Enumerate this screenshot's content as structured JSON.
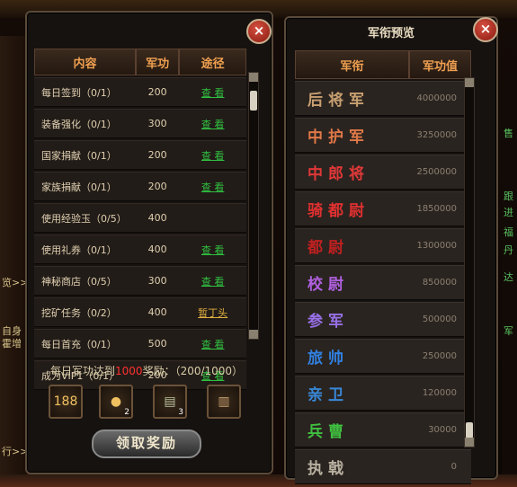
{
  "left_panel": {
    "columns": [
      "内容",
      "军功",
      "途径"
    ],
    "rows": [
      {
        "content": "每日签到（0/1）",
        "merit": "200",
        "action": "查  看"
      },
      {
        "content": "装备强化（0/1）",
        "merit": "300",
        "action": "查  看"
      },
      {
        "content": "国家捐献（0/1）",
        "merit": "200",
        "action": "查  看"
      },
      {
        "content": "家族捐献（0/1）",
        "merit": "200",
        "action": "查  看"
      },
      {
        "content": "使用经验玉（0/5）",
        "merit": "400",
        "action": ""
      },
      {
        "content": "使用礼券（0/1）",
        "merit": "400",
        "action": "查  看"
      },
      {
        "content": "神秘商店（0/5）",
        "merit": "300",
        "action": "查  看"
      },
      {
        "content": "挖矿任务（0/2）",
        "merit": "400",
        "action": "暂丁头"
      },
      {
        "content": "每日首充（0/1）",
        "merit": "500",
        "action": "查  看"
      },
      {
        "content": "成为VIP1（0/1）",
        "merit": "200",
        "action": "查  看"
      }
    ],
    "goal_prefix": "每日军功达到",
    "goal_amount": "1000",
    "goal_suffix": "奖励：（200/1000）",
    "rewards": [
      {
        "icon": "gold-ticket-icon",
        "label": "188",
        "count": ""
      },
      {
        "icon": "fire-orb-icon",
        "label": "",
        "count": "2"
      },
      {
        "icon": "scroll-icon",
        "label": "",
        "count": "3"
      },
      {
        "icon": "bamboo-scroll-icon",
        "label": "",
        "count": ""
      }
    ],
    "claim_button": "领取奖励",
    "close_label": "×"
  },
  "right_panel": {
    "title": "军衔预览",
    "columns": [
      "军衔",
      "军功值"
    ],
    "rows": [
      {
        "rank": "后将军",
        "value": "4000000",
        "color": "#c8a070"
      },
      {
        "rank": "中护军",
        "value": "3250000",
        "color": "#e07848"
      },
      {
        "rank": "中郎将",
        "value": "2500000",
        "color": "#e03838"
      },
      {
        "rank": "骑都尉",
        "value": "1850000",
        "color": "#e03030"
      },
      {
        "rank": "都尉",
        "value": "1300000",
        "color": "#c02020"
      },
      {
        "rank": "校尉",
        "value": "850000",
        "color": "#b060e0"
      },
      {
        "rank": "参军",
        "value": "500000",
        "color": "#9870e8"
      },
      {
        "rank": "旅帅",
        "value": "250000",
        "color": "#3080e0"
      },
      {
        "rank": "亲卫",
        "value": "120000",
        "color": "#3888d8"
      },
      {
        "rank": "兵曹",
        "value": "30000",
        "color": "#40c040"
      },
      {
        "rank": "执戟",
        "value": "0",
        "color": "#b8b0a0"
      }
    ],
    "close_label": "×"
  },
  "left_strip": [
    "览>>",
    "自身",
    "霍增",
    "行>>"
  ],
  "right_strip": [
    "售",
    "跟",
    "进",
    "福",
    "丹",
    "达",
    "军"
  ]
}
